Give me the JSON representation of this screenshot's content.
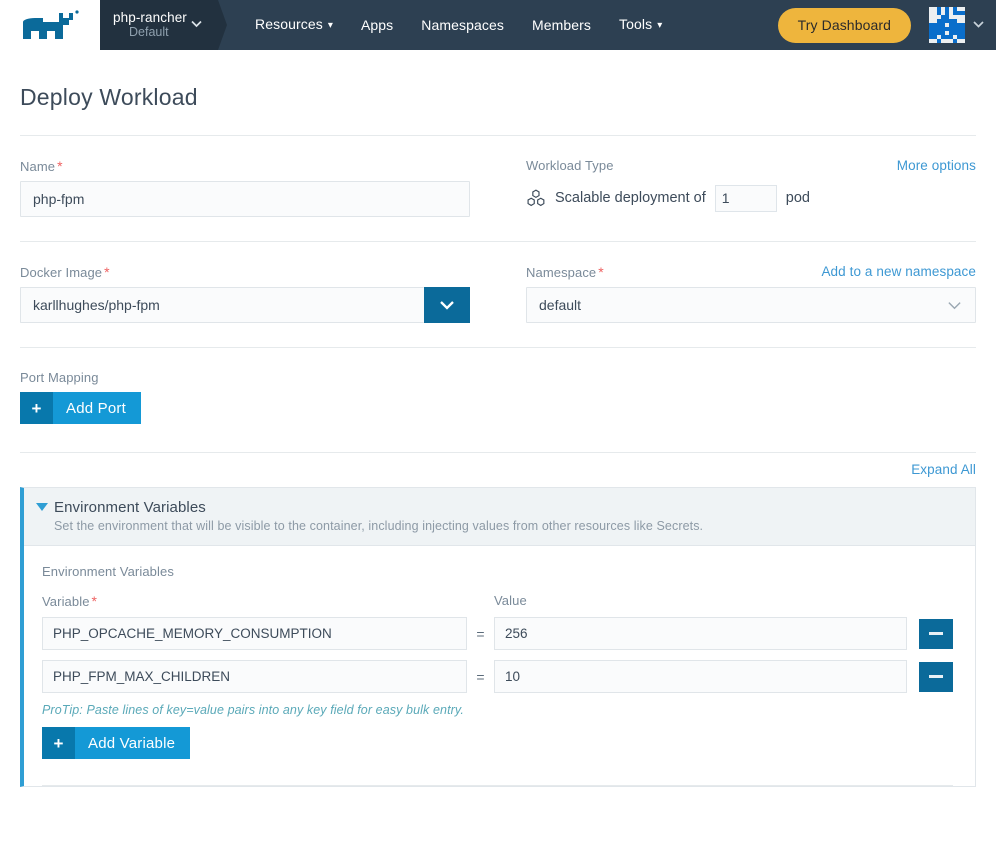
{
  "header": {
    "logo_icon": "rancher-bull-logo",
    "cluster": {
      "name": "php-rancher",
      "sub": "Default",
      "caret_icon": "chevron-down-icon"
    },
    "nav_items": [
      {
        "label": "Resources",
        "has_caret": true
      },
      {
        "label": "Apps",
        "has_caret": false
      },
      {
        "label": "Namespaces",
        "has_caret": false
      },
      {
        "label": "Members",
        "has_caret": false
      },
      {
        "label": "Tools",
        "has_caret": true
      }
    ],
    "try_dashboard_label": "Try Dashboard",
    "avatar_icon": "user-identicon-avatar",
    "avatar_caret_icon": "chevron-down-icon",
    "colors": {
      "bar": "#2d4052",
      "cluster_bg": "#22313f",
      "try_dashboard": "#eeb53d",
      "logo_blue": "#0b6a9a",
      "avatar_blue": "#0a6ecb"
    }
  },
  "page": {
    "title": "Deploy Workload"
  },
  "name_field": {
    "label": "Name",
    "required": true,
    "value": "php-fpm",
    "placeholder": ""
  },
  "workload_type": {
    "label": "Workload Type",
    "more_options_label": "More options",
    "icon": "scalable-deployment-icon",
    "prefix_text": "Scalable deployment of",
    "pod_count": "1",
    "suffix_text": "pod"
  },
  "docker_image": {
    "label": "Docker Image",
    "required": true,
    "value": "karllhughes/php-fpm",
    "dropdown_icon": "chevron-down-icon"
  },
  "namespace": {
    "label": "Namespace",
    "required": true,
    "value": "default",
    "add_link_label": "Add to a new namespace",
    "dropdown_icon": "chevron-down-icon"
  },
  "port_mapping": {
    "label": "Port Mapping",
    "add_button_label": "Add Port",
    "add_button_icon": "plus-icon"
  },
  "expand_all_label": "Expand All",
  "env_panel": {
    "toggle_icon": "caret-down-icon",
    "title": "Environment Variables",
    "description": "Set the environment that will be visible to the container, including injecting values from other resources like Secrets.",
    "section_label": "Environment Variables",
    "col_variable": "Variable",
    "col_variable_required": true,
    "col_value": "Value",
    "equals_sign": "=",
    "rows": [
      {
        "key": "PHP_OPCACHE_MEMORY_CONSUMPTION",
        "value": "256",
        "remove_icon": "minus-icon"
      },
      {
        "key": "PHP_FPM_MAX_CHILDREN",
        "value": "10",
        "remove_icon": "minus-icon"
      }
    ],
    "protip": "ProTip: Paste lines of key=value pairs into any key field for easy bulk entry.",
    "add_button_label": "Add Variable",
    "add_button_icon": "plus-icon"
  }
}
